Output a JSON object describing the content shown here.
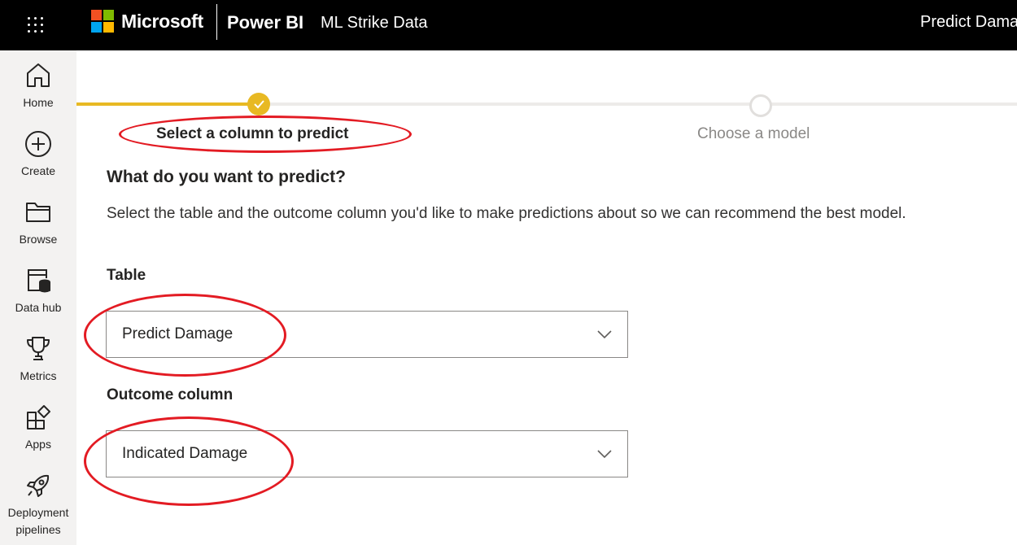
{
  "header": {
    "brand": "Microsoft",
    "product": "Power BI",
    "workspace": "ML Strike Data",
    "item_title": "Predict Dama"
  },
  "nav": {
    "items": [
      {
        "label": "Home",
        "icon": "home-icon"
      },
      {
        "label": "Create",
        "icon": "plus-circle-icon"
      },
      {
        "label": "Browse",
        "icon": "folder-icon"
      },
      {
        "label": "Data hub",
        "icon": "data-hub-icon"
      },
      {
        "label": "Metrics",
        "icon": "trophy-icon"
      },
      {
        "label": "Apps",
        "icon": "apps-icon"
      },
      {
        "label": "Deployment pipelines",
        "icon": "rocket-icon"
      }
    ]
  },
  "stepper": {
    "steps": [
      {
        "label": "Select a column to predict",
        "state": "complete"
      },
      {
        "label": "Choose a model",
        "state": "pending"
      }
    ]
  },
  "main": {
    "heading": "What do you want to predict?",
    "description": "Select the table and the outcome column you'd like to make predictions about so we can recommend the best model.",
    "table_label": "Table",
    "table_value": "Predict Damage",
    "outcome_label": "Outcome column",
    "outcome_value": "Indicated Damage"
  },
  "colors": {
    "accent": "#e8b923",
    "annotation": "#e31b23",
    "topbar": "#000000",
    "nav_bg": "#f3f2f1"
  }
}
